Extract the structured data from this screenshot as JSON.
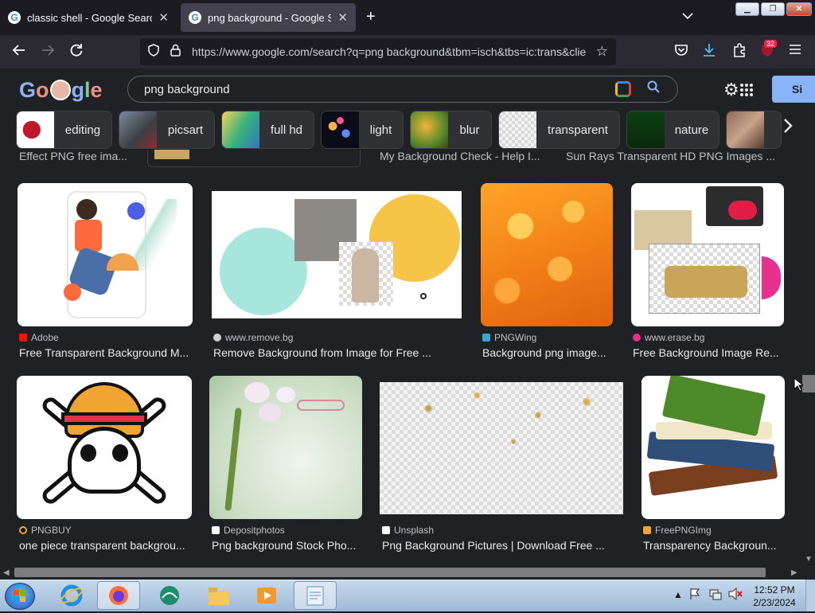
{
  "browser": {
    "tabs": [
      {
        "title": "classic shell - Google Search",
        "active": false
      },
      {
        "title": "png background - Google Search",
        "active": true
      }
    ],
    "url": "https://www.google.com/search?q=png background&tbm=isch&tbs=ic:trans&clie",
    "extensions_badge": "32",
    "colors": {
      "tabbar": "#1c1b22",
      "toolbar": "#2b2a33",
      "active_tab": "#42414d"
    }
  },
  "google": {
    "logo_text": "Google",
    "query": "png background",
    "signin_label": "Si"
  },
  "chips": [
    {
      "label": "editing"
    },
    {
      "label": "picsart"
    },
    {
      "label": "full hd"
    },
    {
      "label": "light"
    },
    {
      "label": "blur"
    },
    {
      "label": "transparent"
    },
    {
      "label": "nature"
    }
  ],
  "previous_row": {
    "titles": [
      "Effect PNG free ima...",
      "My Background Check - Help I...",
      "Sun Rays Transparent HD PNG Images ..."
    ]
  },
  "results": [
    {
      "source": "Adobe",
      "title": "Free Transparent Background M..."
    },
    {
      "source": "www.remove.bg",
      "title": "Remove Background from Image for Free ..."
    },
    {
      "source": "PNGWing",
      "title": "Background png image..."
    },
    {
      "source": "www.erase.bg",
      "title": "Free Background Image Re..."
    },
    {
      "source": "PNGBUY",
      "title": "one piece transparent backgrou..."
    },
    {
      "source": "Depositphotos",
      "title": "Png background Stock Pho..."
    },
    {
      "source": "Unsplash",
      "title": "Png Background Pictures | Download Free ..."
    },
    {
      "source": "FreePNGImg",
      "title": "Transparency Backgroun..."
    }
  ],
  "taskbar": {
    "time": "12:52 PM",
    "date": "2/23/2024"
  }
}
